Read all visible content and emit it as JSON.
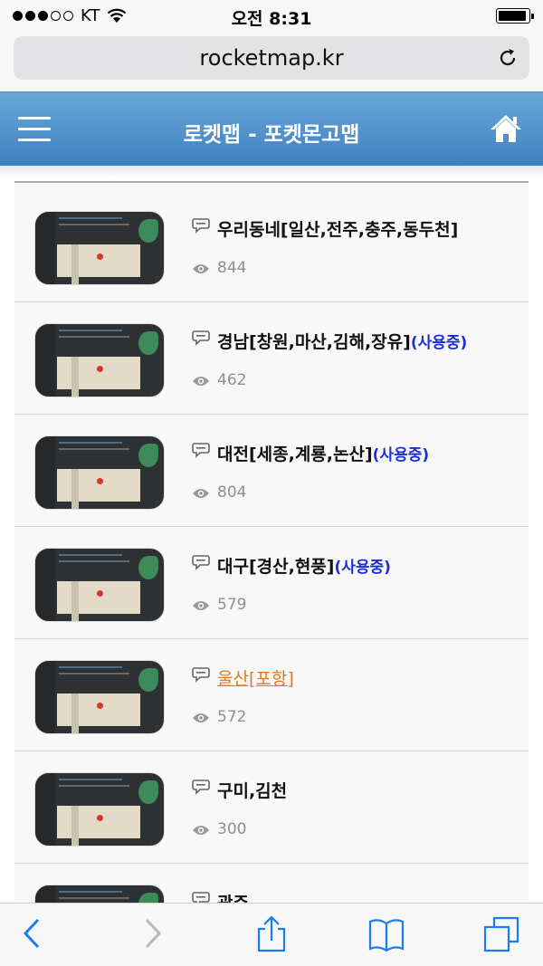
{
  "status_bar": {
    "carrier": "KT",
    "time": "오전 8:31"
  },
  "browser": {
    "url": "rocketmap.kr"
  },
  "header": {
    "title": "로켓맵 - 포켓몬고맵"
  },
  "items": [
    {
      "title": "우리동네[일산,전주,충주,동두천]",
      "tag": "",
      "views": "844"
    },
    {
      "title": "경남[창원,마산,김해,장유]",
      "tag": "(사용중)",
      "views": "462"
    },
    {
      "title": "대전[세종,계룡,논산]",
      "tag": "(사용중)",
      "views": "804"
    },
    {
      "title": "대구[경산,현풍]",
      "tag": "(사용중)",
      "views": "579"
    },
    {
      "title": "울산[포항]",
      "tag": "",
      "views": "572",
      "visited_link": true
    },
    {
      "title": "구미,김천",
      "tag": "",
      "views": "300"
    },
    {
      "title": "광주",
      "tag": "",
      "views": ""
    }
  ],
  "colors": {
    "header_top": "#6aa7d8",
    "header_bottom": "#3f80c2",
    "tag": "#1a2fd8",
    "visited_link": "#e57a1c",
    "ios_blue": "#1a7ef2"
  },
  "icons": [
    "menu-icon",
    "home-icon",
    "comment-icon",
    "eye-icon",
    "reload-icon",
    "back-icon",
    "forward-icon",
    "share-icon",
    "bookmarks-icon",
    "tabs-icon"
  ]
}
